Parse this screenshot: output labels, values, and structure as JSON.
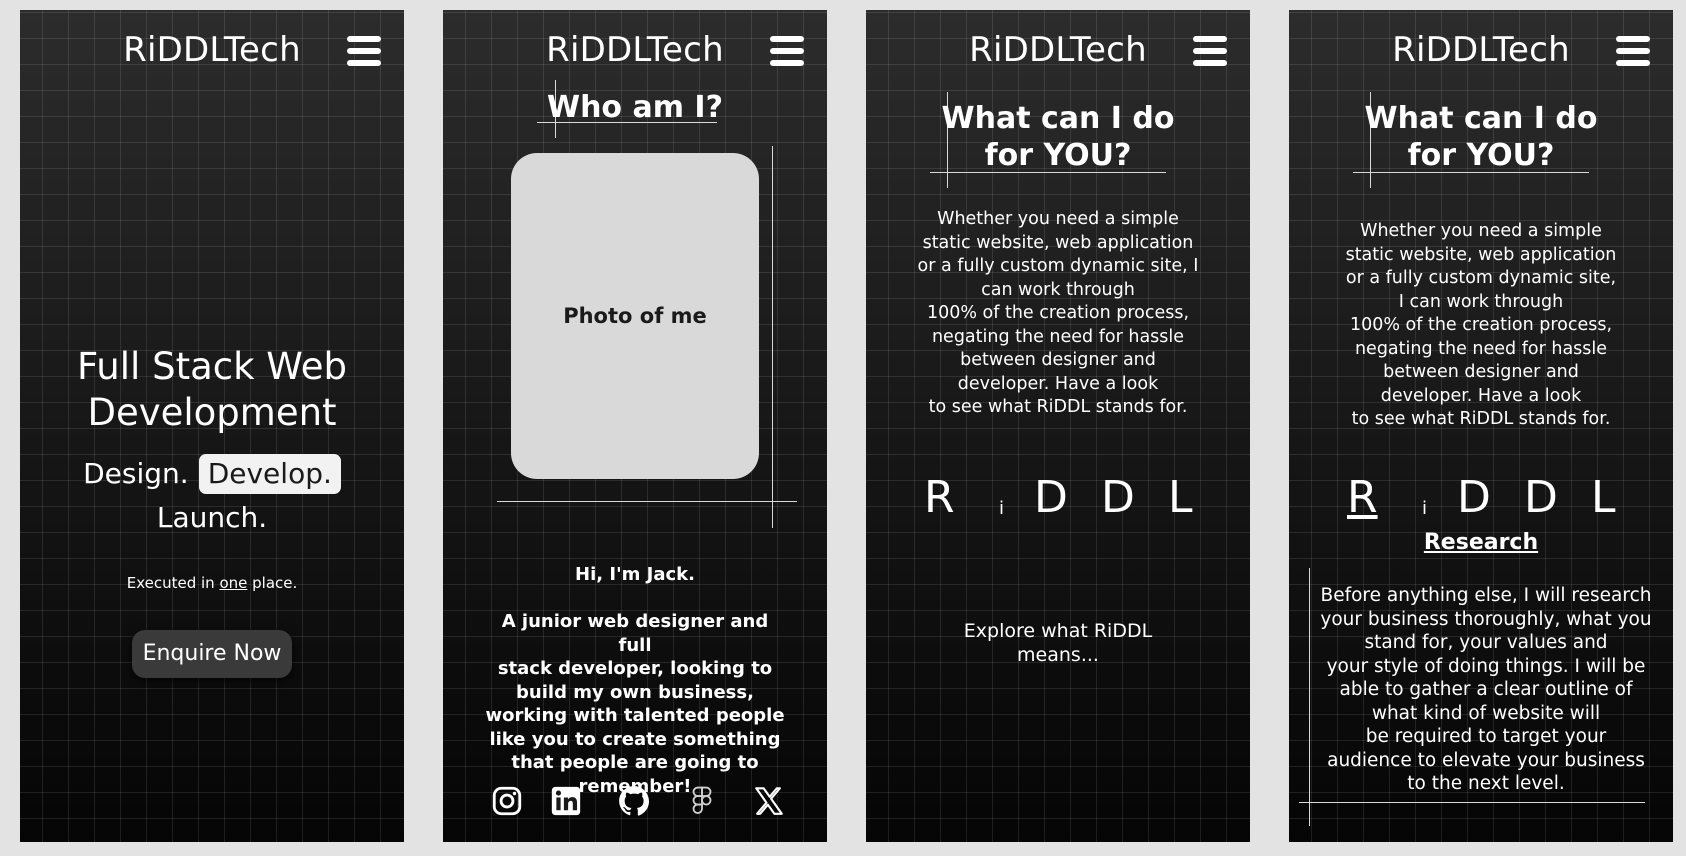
{
  "brand": "RiDDLTech",
  "menu_icon": "hamburger-icon",
  "screen1": {
    "hero_title_line1": "Full Stack Web",
    "hero_title_line2": "Development",
    "tag_design": "Design.",
    "tag_develop": "Develop.",
    "tag_launch": "Launch.",
    "executed_pre": "Executed in ",
    "executed_em": "one",
    "executed_post": " place.",
    "cta": "Enquire Now"
  },
  "screen2": {
    "title": "Who am I?",
    "photo_placeholder": "Photo of me",
    "greeting": "Hi, I'm Jack.",
    "bio_lines": [
      "A junior web designer and full",
      "stack developer, looking to",
      "build my own business,",
      "working with talented people",
      "like you to create something",
      "that people are going to",
      "remember!"
    ],
    "socials": [
      "instagram-icon",
      "linkedin-icon",
      "github-icon",
      "figma-icon",
      "x-icon"
    ]
  },
  "screen3": {
    "title_line1": "What can I do",
    "title_line2": "for YOU?",
    "desc_lines": [
      "Whether you need a simple",
      "static website, web application",
      "or a fully custom dynamic site, I",
      "can work through",
      "100% of the creation process,",
      "negating the need for hassle",
      "between designer and",
      "developer. Have a look",
      "to see what RiDDL stands for."
    ],
    "letters": [
      "R",
      "i",
      "D",
      "D",
      "L"
    ],
    "explore_line1": "Explore what RiDDL",
    "explore_line2": "means..."
  },
  "screen4": {
    "title_line1": "What can I do",
    "title_line2": "for YOU?",
    "desc_lines": [
      "Whether you need a simple",
      "static website, web application",
      "or a fully custom dynamic site,",
      "I can work through",
      "100% of the creation process,",
      "negating the need for hassle",
      "between designer and",
      "developer. Have a look",
      "to see what RiDDL stands for."
    ],
    "letters": [
      "R",
      "i",
      "D",
      "D",
      "L"
    ],
    "active_letter": "R",
    "section_title": "Research",
    "section_lines": [
      "Before anything else, I will research",
      "your business thoroughly, what you",
      "stand for, your values and",
      "your style of doing things. I will be",
      "able to gather a clear outline of",
      "what kind of website will",
      "be required to target your",
      "audience to elevate your business",
      "to the next level."
    ]
  }
}
